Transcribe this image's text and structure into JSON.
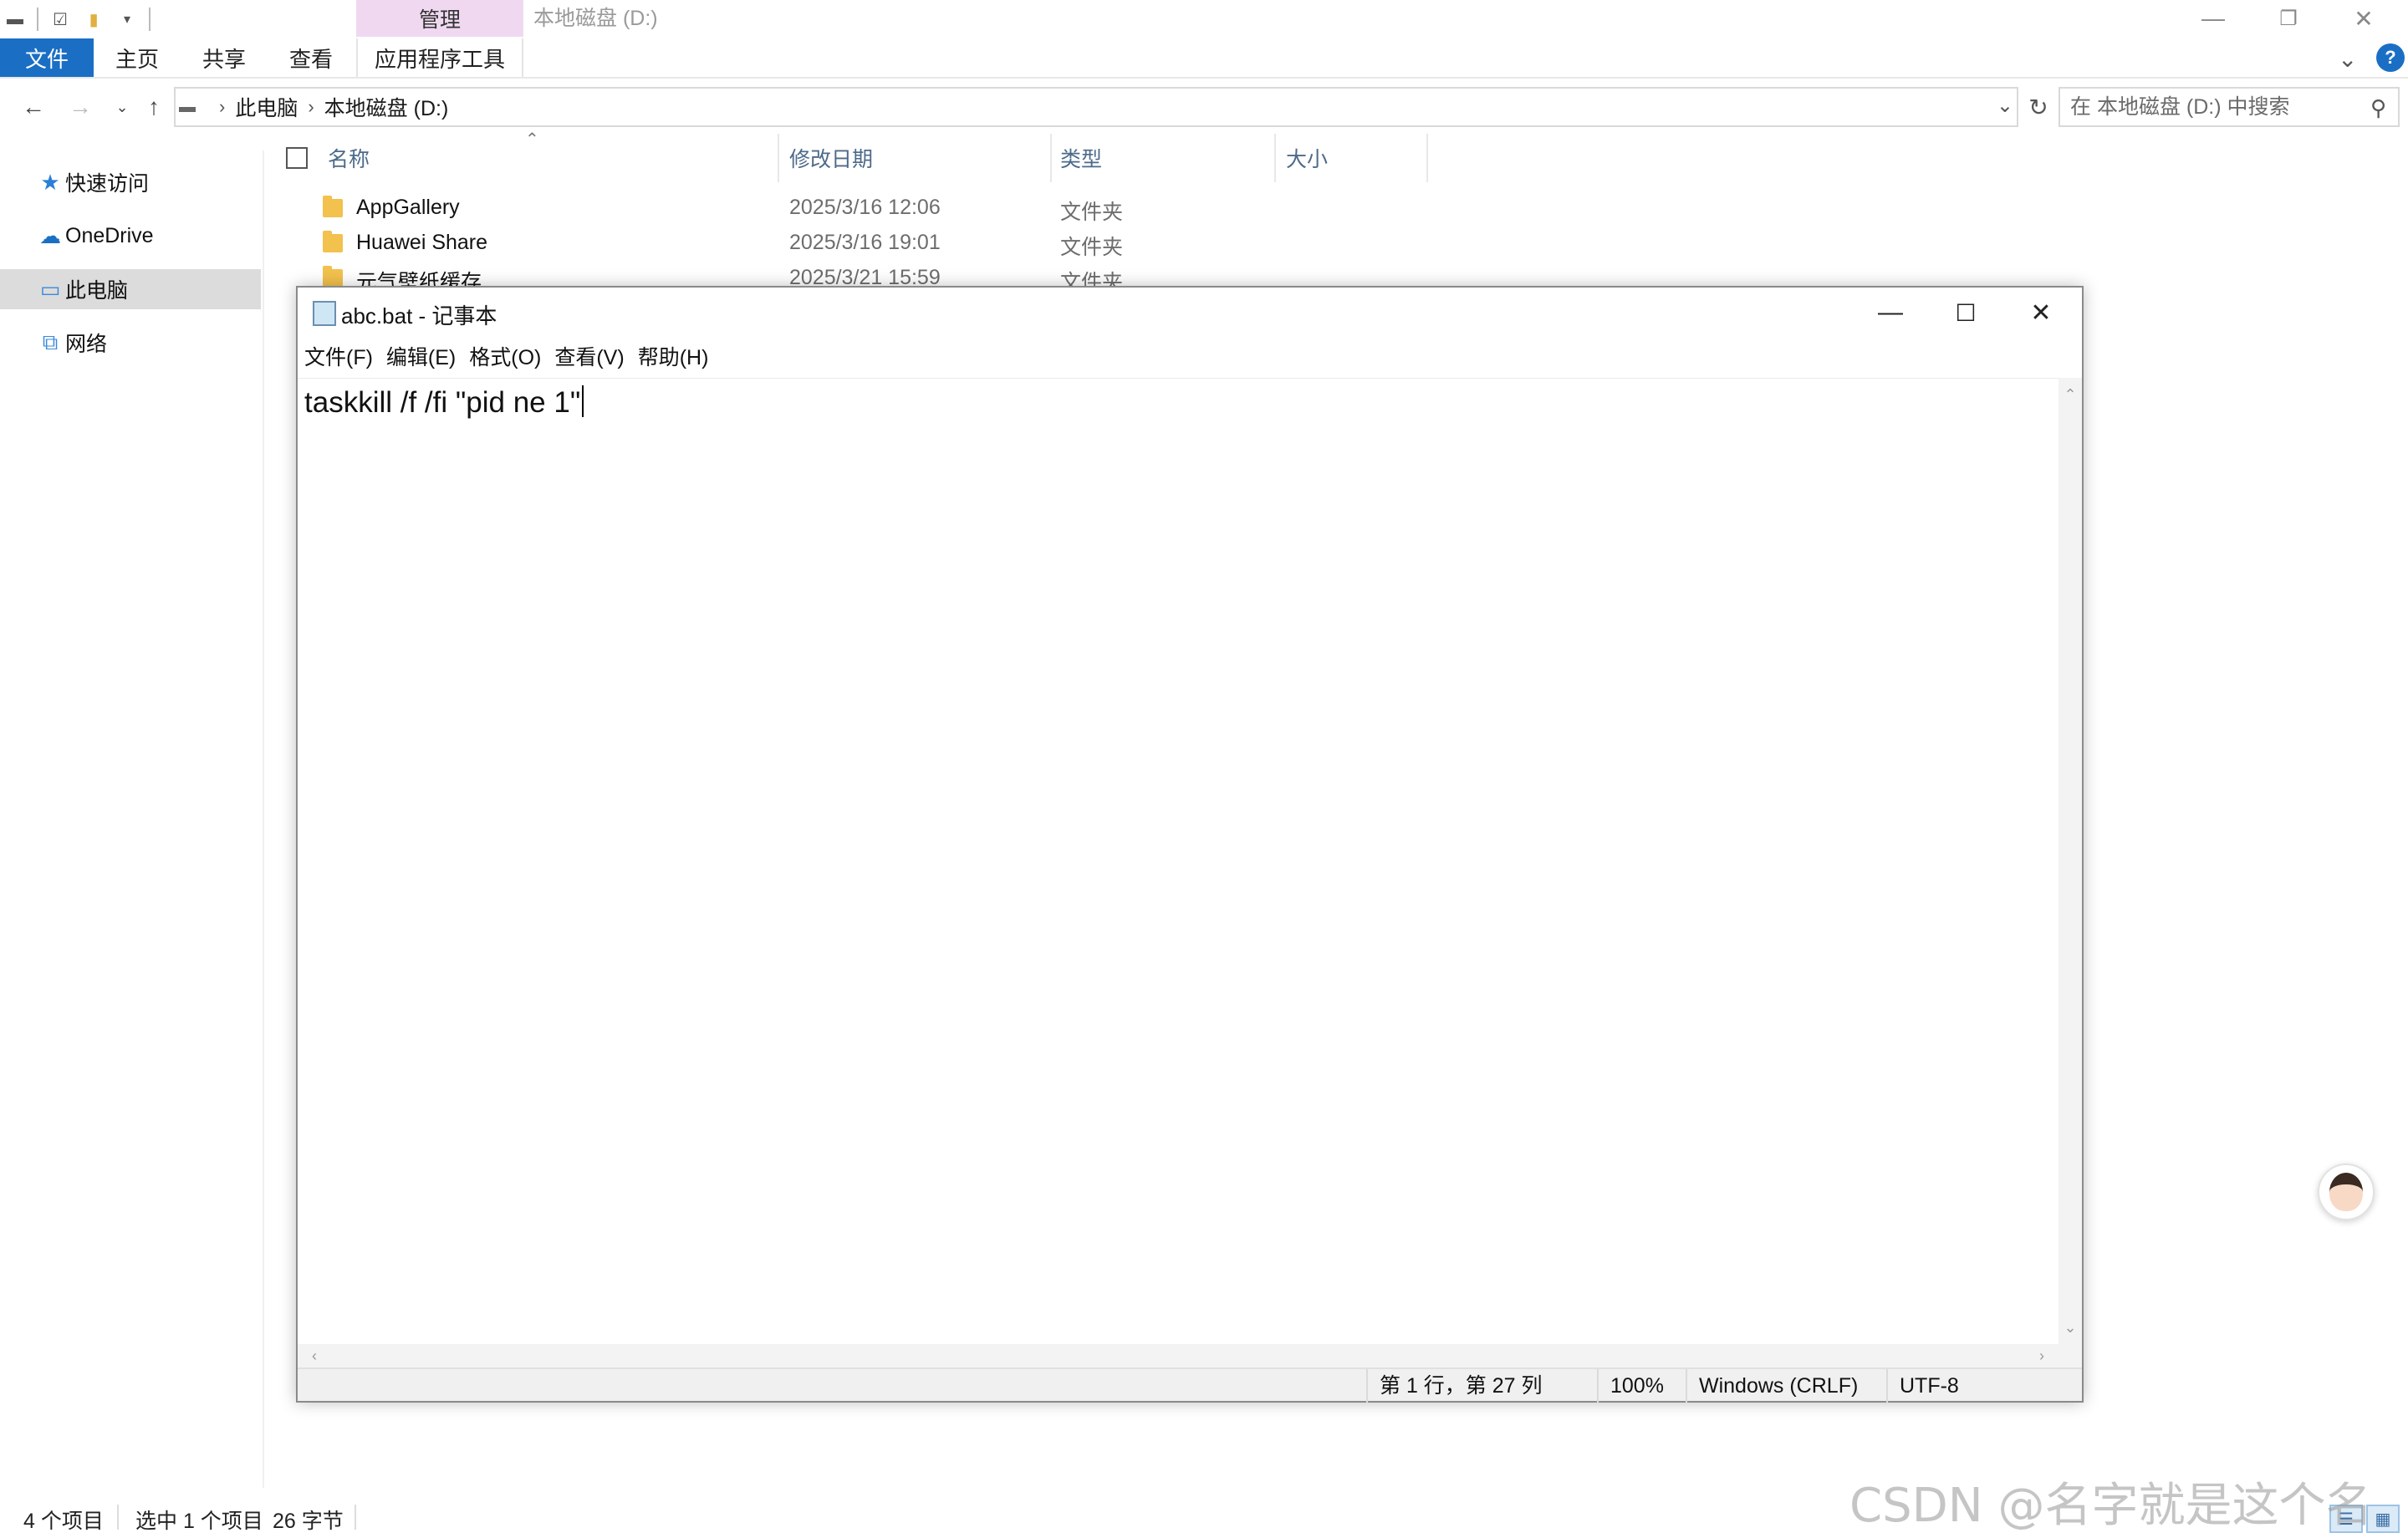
{
  "explorer": {
    "title": "本地磁盘 (D:)",
    "context_tab": "管理",
    "ribbon": {
      "file": "文件",
      "tabs": [
        "主页",
        "共享",
        "查看"
      ],
      "app_tools": "应用程序工具"
    },
    "breadcrumb": [
      "此电脑",
      "本地磁盘 (D:)"
    ],
    "search_placeholder": "在 本地磁盘 (D:) 中搜索",
    "nav": [
      {
        "label": "快速访问",
        "icon": "star-icon"
      },
      {
        "label": "OneDrive",
        "icon": "cloud-icon"
      },
      {
        "label": "此电脑",
        "icon": "computer-icon",
        "selected": true
      },
      {
        "label": "网络",
        "icon": "network-icon"
      }
    ],
    "columns": {
      "name": "名称",
      "date": "修改日期",
      "type": "类型",
      "size": "大小"
    },
    "files": [
      {
        "name": "AppGallery",
        "date": "2025/3/16 12:06",
        "type": "文件夹"
      },
      {
        "name": "Huawei Share",
        "date": "2025/3/16 19:01",
        "type": "文件夹"
      },
      {
        "name": "元气壁纸缓存",
        "date": "2025/3/21 15:59",
        "type": "文件夹"
      }
    ],
    "status": {
      "count": "4 个项目",
      "selected": "选中 1 个项目",
      "size": "26 字节"
    }
  },
  "notepad": {
    "title": "abc.bat - 记事本",
    "menu": [
      "文件(F)",
      "编辑(E)",
      "格式(O)",
      "查看(V)",
      "帮助(H)"
    ],
    "content": "taskkill /f /fi \"pid ne 1\"",
    "status": {
      "position": "第 1 行，第 27 列",
      "zoom": "100%",
      "line_ending": "Windows (CRLF)",
      "encoding": "UTF-8"
    }
  },
  "watermark": "CSDN @名字就是这个名字",
  "colors": {
    "accent": "#1a6fc4",
    "context_tab": "#f0d9f0",
    "folder": "#f2c14e"
  }
}
